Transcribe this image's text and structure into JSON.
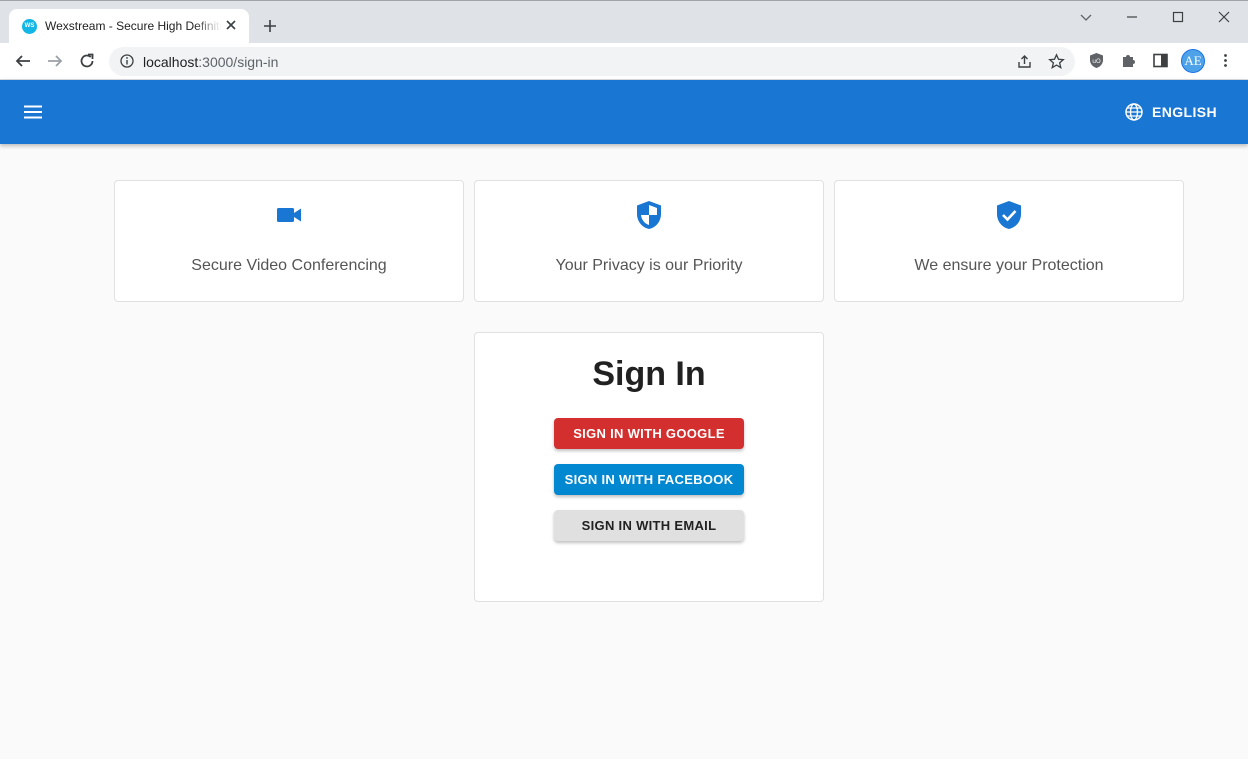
{
  "browser": {
    "tab_title": "Wexstream - Secure High Definition",
    "favicon_text": "WS",
    "url_host": "localhost",
    "url_path": ":3000/sign-in",
    "avatar_initials": "AE",
    "icons": [
      "back-arrow-icon",
      "forward-arrow-icon",
      "reload-icon",
      "info-icon",
      "share-icon",
      "star-icon",
      "shield-extension-icon",
      "puzzle-extensions-icon",
      "side-panel-icon",
      "kebab-menu-icon"
    ]
  },
  "appbar": {
    "language_label": "ENGLISH",
    "color": "#1976d2"
  },
  "features": [
    {
      "label": "Secure Video Conferencing",
      "icon": "videocam-icon"
    },
    {
      "label": "Your Privacy is our Priority",
      "icon": "privacy-shield-icon"
    },
    {
      "label": "We ensure your Protection",
      "icon": "verified-shield-icon"
    }
  ],
  "signin": {
    "title": "Sign In",
    "google_label": "SIGN IN WITH GOOGLE",
    "facebook_label": "SIGN IN WITH FACEBOOK",
    "email_label": "SIGN IN WITH EMAIL"
  },
  "colors": {
    "accent": "#1976d2",
    "google": "#d32f2f",
    "facebook": "#0288d1",
    "email": "#e0e0e0"
  }
}
